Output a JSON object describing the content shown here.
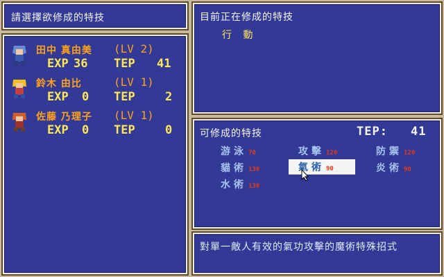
{
  "header_left": "請選擇欲修成的特技",
  "header_right": "目前正在修成的特技",
  "current_skill": "行 動",
  "characters": [
    {
      "name": "田中 真由美",
      "level": "(LV 2)",
      "exp_label": "EXP",
      "exp": "36",
      "tep_label": "TEP",
      "tep": "41"
    },
    {
      "name": "鈴木 由比",
      "level": "(LV 1)",
      "exp_label": "EXP",
      "exp": "0",
      "tep_label": "TEP",
      "tep": "2"
    },
    {
      "name": "佐藤 乃理子",
      "level": "(LV 1)",
      "exp_label": "EXP",
      "exp": "0",
      "tep_label": "TEP",
      "tep": "0"
    }
  ],
  "learnable_title": "可修成的特技",
  "tep_label": "TEP:",
  "tep_value": "41",
  "skills": [
    {
      "name": "游泳",
      "cost": "70"
    },
    {
      "name": "攻擊",
      "cost": "120"
    },
    {
      "name": "防禦",
      "cost": "120"
    },
    {
      "name": "貓術",
      "cost": "130"
    },
    {
      "name": "氣術",
      "cost": "90",
      "selected": true
    },
    {
      "name": "炎術",
      "cost": "90"
    },
    {
      "name": "水術",
      "cost": "130"
    }
  ],
  "description": "對單一敵人有效的氣功攻擊的魔術特殊招式",
  "colors": {
    "panel": "#323a96",
    "frame": "#c9ba9a",
    "name_orange": "#ffa21a",
    "stat_yellow": "#ffe85a",
    "skill_blue": "#a8c2ee",
    "cost_red": "#e23a1a"
  }
}
